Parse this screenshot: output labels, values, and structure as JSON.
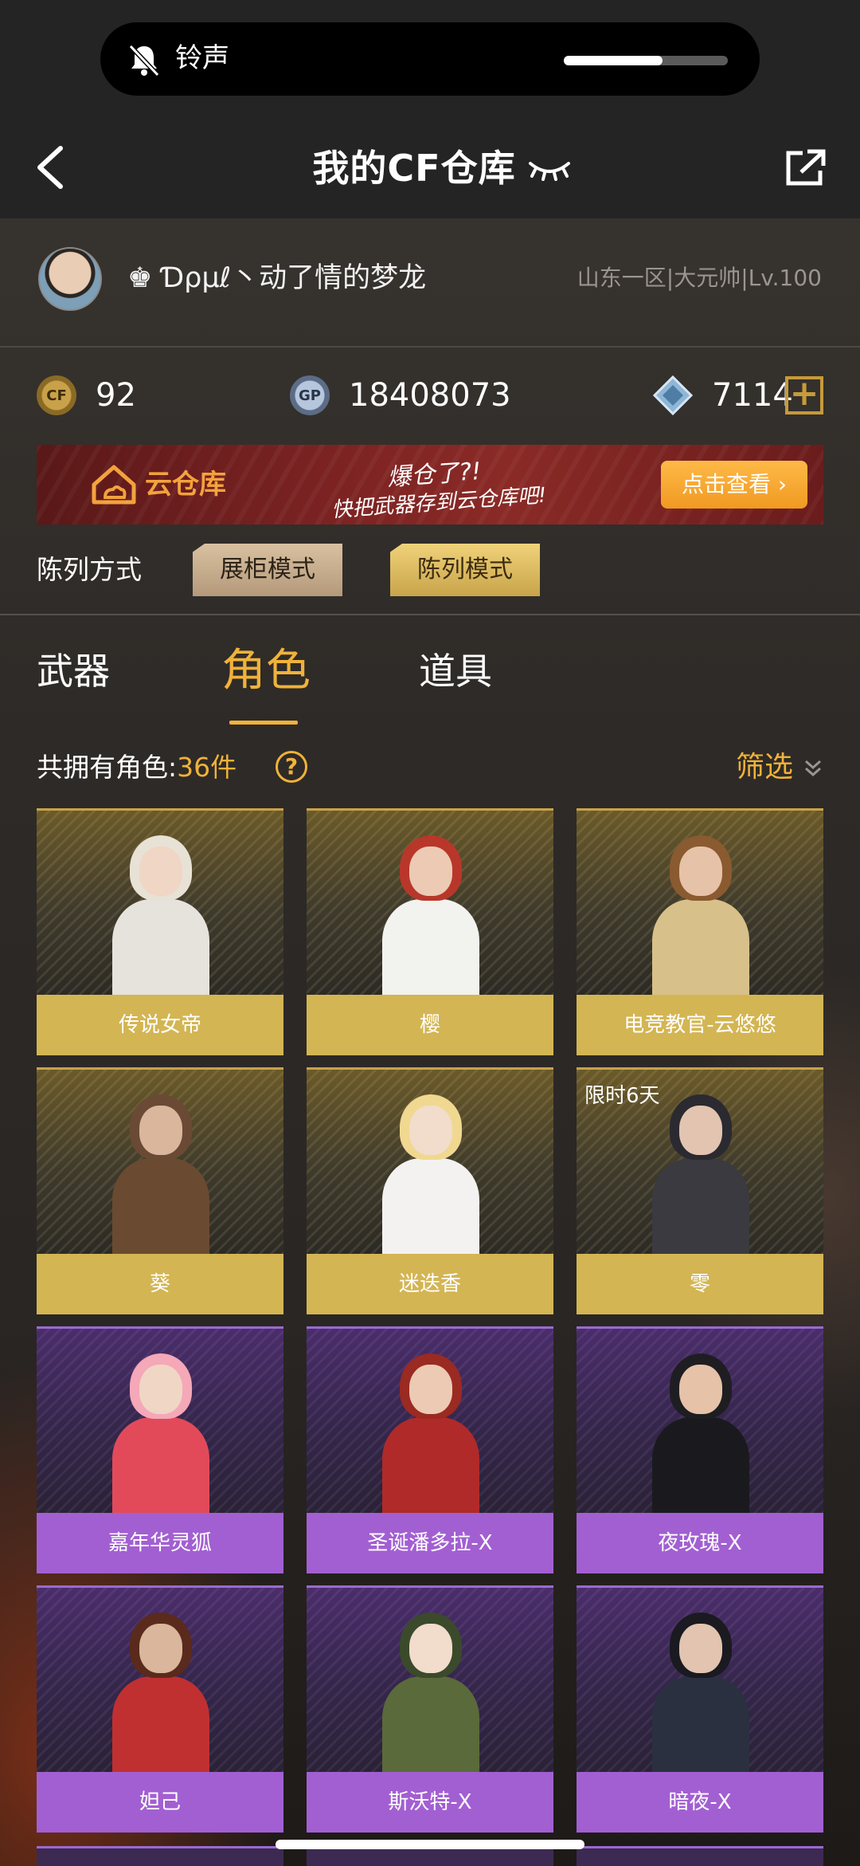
{
  "status": {
    "ringer_text": "铃声",
    "volume_level": 0.6
  },
  "header": {
    "title": "我的CF仓库"
  },
  "profile": {
    "player_name": "♚ Ɗρμℓ丶动了情的梦龙",
    "server_info": "山东一区|大元帅|Lv.100"
  },
  "currency": {
    "cf_icon": "CF",
    "cf_value": "92",
    "gp_icon": "GP",
    "gp_value": "18408073",
    "diamond_value": "7114",
    "add_label": "+"
  },
  "banner": {
    "label": "云仓库",
    "slogan_line1": "爆仓了?!",
    "slogan_line2": "快把武器存到云仓库吧!",
    "button_label": "点击查看 ›"
  },
  "display": {
    "label": "陈列方式",
    "modes": [
      "展柜模式",
      "陈列模式"
    ]
  },
  "tabs": {
    "weapons": "武器",
    "characters": "角色",
    "items": "道具"
  },
  "summary": {
    "prefix": "共拥有角色:",
    "count": "36件",
    "help": "?",
    "filter": "筛选"
  },
  "colors": {
    "accent": "#f0b23a",
    "gold_card": "#d3b553",
    "purple_card": "#a25fd2"
  },
  "characters": [
    {
      "name": "传说女帝",
      "rarity": "gold",
      "tag": ""
    },
    {
      "name": "樱",
      "rarity": "gold",
      "tag": ""
    },
    {
      "name": "电竞教官-云悠悠",
      "rarity": "gold",
      "tag": ""
    },
    {
      "name": "葵",
      "rarity": "gold",
      "tag": ""
    },
    {
      "name": "迷迭香",
      "rarity": "gold",
      "tag": ""
    },
    {
      "name": "零",
      "rarity": "gold",
      "tag": "限时6天"
    },
    {
      "name": "嘉年华灵狐",
      "rarity": "purple",
      "tag": ""
    },
    {
      "name": "圣诞潘多拉-X",
      "rarity": "purple",
      "tag": ""
    },
    {
      "name": "夜玫瑰-X",
      "rarity": "purple",
      "tag": ""
    },
    {
      "name": "妲己",
      "rarity": "purple",
      "tag": ""
    },
    {
      "name": "斯沃特-X",
      "rarity": "purple",
      "tag": ""
    },
    {
      "name": "暗夜-X",
      "rarity": "purple",
      "tag": ""
    }
  ]
}
